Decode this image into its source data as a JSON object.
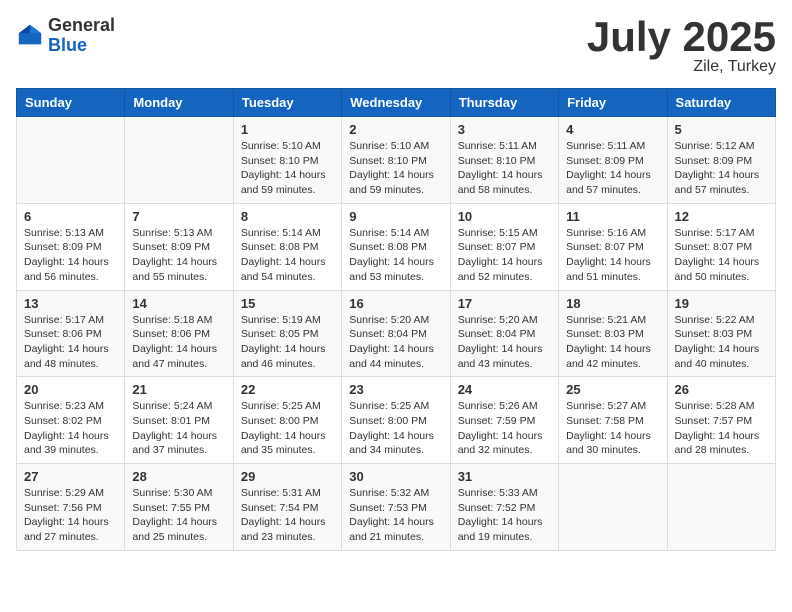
{
  "header": {
    "logo_general": "General",
    "logo_blue": "Blue",
    "month_title": "July 2025",
    "subtitle": "Zile, Turkey"
  },
  "days_of_week": [
    "Sunday",
    "Monday",
    "Tuesday",
    "Wednesday",
    "Thursday",
    "Friday",
    "Saturday"
  ],
  "weeks": [
    [
      {
        "day": "",
        "info": ""
      },
      {
        "day": "",
        "info": ""
      },
      {
        "day": "1",
        "info": "Sunrise: 5:10 AM\nSunset: 8:10 PM\nDaylight: 14 hours and 59 minutes."
      },
      {
        "day": "2",
        "info": "Sunrise: 5:10 AM\nSunset: 8:10 PM\nDaylight: 14 hours and 59 minutes."
      },
      {
        "day": "3",
        "info": "Sunrise: 5:11 AM\nSunset: 8:10 PM\nDaylight: 14 hours and 58 minutes."
      },
      {
        "day": "4",
        "info": "Sunrise: 5:11 AM\nSunset: 8:09 PM\nDaylight: 14 hours and 57 minutes."
      },
      {
        "day": "5",
        "info": "Sunrise: 5:12 AM\nSunset: 8:09 PM\nDaylight: 14 hours and 57 minutes."
      }
    ],
    [
      {
        "day": "6",
        "info": "Sunrise: 5:13 AM\nSunset: 8:09 PM\nDaylight: 14 hours and 56 minutes."
      },
      {
        "day": "7",
        "info": "Sunrise: 5:13 AM\nSunset: 8:09 PM\nDaylight: 14 hours and 55 minutes."
      },
      {
        "day": "8",
        "info": "Sunrise: 5:14 AM\nSunset: 8:08 PM\nDaylight: 14 hours and 54 minutes."
      },
      {
        "day": "9",
        "info": "Sunrise: 5:14 AM\nSunset: 8:08 PM\nDaylight: 14 hours and 53 minutes."
      },
      {
        "day": "10",
        "info": "Sunrise: 5:15 AM\nSunset: 8:07 PM\nDaylight: 14 hours and 52 minutes."
      },
      {
        "day": "11",
        "info": "Sunrise: 5:16 AM\nSunset: 8:07 PM\nDaylight: 14 hours and 51 minutes."
      },
      {
        "day": "12",
        "info": "Sunrise: 5:17 AM\nSunset: 8:07 PM\nDaylight: 14 hours and 50 minutes."
      }
    ],
    [
      {
        "day": "13",
        "info": "Sunrise: 5:17 AM\nSunset: 8:06 PM\nDaylight: 14 hours and 48 minutes."
      },
      {
        "day": "14",
        "info": "Sunrise: 5:18 AM\nSunset: 8:06 PM\nDaylight: 14 hours and 47 minutes."
      },
      {
        "day": "15",
        "info": "Sunrise: 5:19 AM\nSunset: 8:05 PM\nDaylight: 14 hours and 46 minutes."
      },
      {
        "day": "16",
        "info": "Sunrise: 5:20 AM\nSunset: 8:04 PM\nDaylight: 14 hours and 44 minutes."
      },
      {
        "day": "17",
        "info": "Sunrise: 5:20 AM\nSunset: 8:04 PM\nDaylight: 14 hours and 43 minutes."
      },
      {
        "day": "18",
        "info": "Sunrise: 5:21 AM\nSunset: 8:03 PM\nDaylight: 14 hours and 42 minutes."
      },
      {
        "day": "19",
        "info": "Sunrise: 5:22 AM\nSunset: 8:03 PM\nDaylight: 14 hours and 40 minutes."
      }
    ],
    [
      {
        "day": "20",
        "info": "Sunrise: 5:23 AM\nSunset: 8:02 PM\nDaylight: 14 hours and 39 minutes."
      },
      {
        "day": "21",
        "info": "Sunrise: 5:24 AM\nSunset: 8:01 PM\nDaylight: 14 hours and 37 minutes."
      },
      {
        "day": "22",
        "info": "Sunrise: 5:25 AM\nSunset: 8:00 PM\nDaylight: 14 hours and 35 minutes."
      },
      {
        "day": "23",
        "info": "Sunrise: 5:25 AM\nSunset: 8:00 PM\nDaylight: 14 hours and 34 minutes."
      },
      {
        "day": "24",
        "info": "Sunrise: 5:26 AM\nSunset: 7:59 PM\nDaylight: 14 hours and 32 minutes."
      },
      {
        "day": "25",
        "info": "Sunrise: 5:27 AM\nSunset: 7:58 PM\nDaylight: 14 hours and 30 minutes."
      },
      {
        "day": "26",
        "info": "Sunrise: 5:28 AM\nSunset: 7:57 PM\nDaylight: 14 hours and 28 minutes."
      }
    ],
    [
      {
        "day": "27",
        "info": "Sunrise: 5:29 AM\nSunset: 7:56 PM\nDaylight: 14 hours and 27 minutes."
      },
      {
        "day": "28",
        "info": "Sunrise: 5:30 AM\nSunset: 7:55 PM\nDaylight: 14 hours and 25 minutes."
      },
      {
        "day": "29",
        "info": "Sunrise: 5:31 AM\nSunset: 7:54 PM\nDaylight: 14 hours and 23 minutes."
      },
      {
        "day": "30",
        "info": "Sunrise: 5:32 AM\nSunset: 7:53 PM\nDaylight: 14 hours and 21 minutes."
      },
      {
        "day": "31",
        "info": "Sunrise: 5:33 AM\nSunset: 7:52 PM\nDaylight: 14 hours and 19 minutes."
      },
      {
        "day": "",
        "info": ""
      },
      {
        "day": "",
        "info": ""
      }
    ]
  ]
}
